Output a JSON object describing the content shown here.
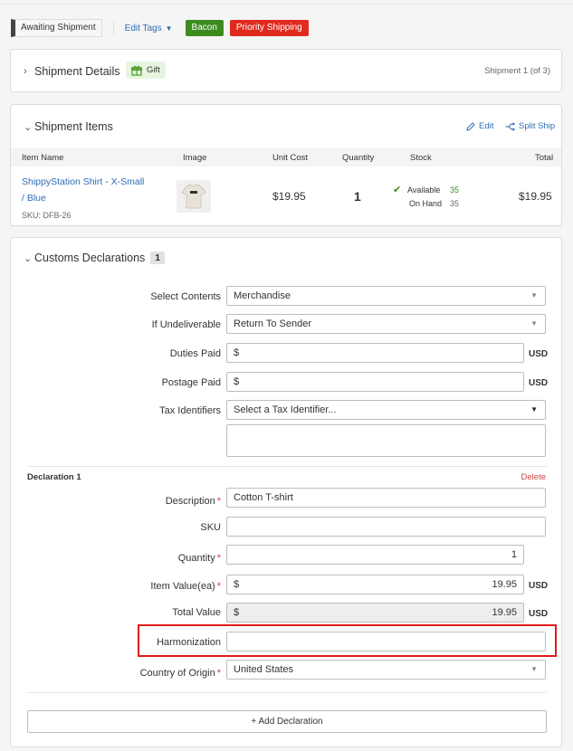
{
  "tagbar": {
    "status": "Awaiting Shipment",
    "edit_tags": "Edit Tags",
    "tags": [
      {
        "label": "Bacon",
        "color": "#3d8b1f"
      },
      {
        "label": "Priority Shipping",
        "color": "#e02a1e"
      }
    ]
  },
  "shipment_details": {
    "title": "Shipment Details",
    "gift": "Gift",
    "counter": "Shipment 1 (of 3)"
  },
  "shipment_items": {
    "title": "Shipment Items",
    "edit": "Edit",
    "split": "Split Ship",
    "columns": [
      "Item Name",
      "Image",
      "Unit Cost",
      "Quantity",
      "Stock",
      "Total"
    ],
    "item": {
      "name_line1": "ShippyStation Shirt - X-Small",
      "name_line2": "/ Blue",
      "sku": "SKU: DFB-26",
      "unit_cost": "$19.95",
      "quantity": "1",
      "available_label": "Available",
      "available": "35",
      "onhand_label": "On Hand",
      "onhand": "35",
      "total": "$19.95"
    }
  },
  "customs": {
    "title": "Customs Declarations",
    "count": "1",
    "select_contents_label": "Select Contents",
    "select_contents": "Merchandise",
    "undeliverable_label": "If Undeliverable",
    "undeliverable": "Return To Sender",
    "duties_label": "Duties Paid",
    "postage_label": "Postage Paid",
    "currency_symbol": "$",
    "usd": "USD",
    "tax_label": "Tax Identifiers",
    "tax_placeholder": "Select a Tax Identifier...",
    "declaration_title": "Declaration 1",
    "delete": "Delete",
    "description_label": "Description",
    "description": "Cotton T-shirt",
    "sku_label": "SKU",
    "quantity_label": "Quantity",
    "quantity": "1",
    "item_value_label": "Item Value(ea)",
    "item_value": "19.95",
    "total_value_label": "Total Value",
    "total_value": "19.95",
    "harmonization_label": "Harmonization",
    "country_label": "Country of Origin",
    "country": "United States",
    "add_declaration": "+ Add Declaration"
  }
}
